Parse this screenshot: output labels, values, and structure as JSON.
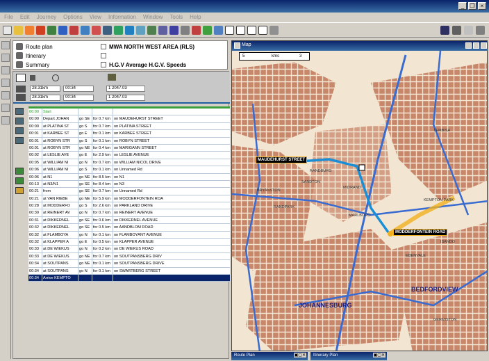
{
  "titlebar": {
    "title": "",
    "controls": [
      "_",
      "❐",
      "×"
    ]
  },
  "menubar": {
    "items": [
      "File",
      "Edit",
      "Journey",
      "Options",
      "View",
      "Information",
      "Window",
      "Tools",
      "Help"
    ]
  },
  "options": {
    "items": [
      {
        "label": "Route plan"
      },
      {
        "label": "Itinerary"
      },
      {
        "label": "Summary"
      }
    ],
    "area_label": "MWA NORTH WEST AREA (RLS)",
    "speed_label": "H.G.V Average H.G.V. Speeds"
  },
  "route_stats": {
    "row1": [
      "28.31km",
      "00:34",
      "1 2047.03"
    ],
    "row2": [
      "28.31km",
      "00:34",
      "1 2047.03"
    ]
  },
  "route_table": [
    {
      "time": "00:00",
      "desc": "Start",
      "dir": "",
      "dist": "",
      "road": "",
      "cls": "first"
    },
    {
      "time": "00:00",
      "desc": "Depart JOHAN",
      "dir": "go SE",
      "dist": "for 0.7 km",
      "road": "on MAUDEHURST STREET"
    },
    {
      "time": "00:00",
      "desc": "at PLATINA ST",
      "dir": "go S",
      "dist": "for 0.7 km",
      "road": "on PLATINA STREET"
    },
    {
      "time": "00:01",
      "desc": "at KARBEE ST",
      "dir": "go E",
      "dist": "for 0.1 km",
      "road": "on KARBEE STREET"
    },
    {
      "time": "00:01",
      "desc": "at ROBYN STR",
      "dir": "go S",
      "dist": "for 0.1 km",
      "road": "on ROBYN STREET"
    },
    {
      "time": "00:01",
      "desc": "at ROBYN STR",
      "dir": "go NE",
      "dist": "for 0.4 km",
      "road": "on MARIGANN STREET"
    },
    {
      "time": "00:02",
      "desc": "at LESLIE AVE",
      "dir": "go E",
      "dist": "for 2.9 km",
      "road": "on LESLIE AVENUE"
    },
    {
      "time": "00:05",
      "desc": "at WILLIAM NI",
      "dir": "go N",
      "dist": "for 0.7 km",
      "road": "on WILLIAM NICOL DRIVE"
    },
    {
      "time": "00:06",
      "desc": "at WILLIAM NI",
      "dir": "go S",
      "dist": "for 0.1 km",
      "road": "on Unnamed Rd"
    },
    {
      "time": "00:06",
      "desc": "at N1",
      "dir": "go NE",
      "dist": "for 8.5 km",
      "road": "on N1"
    },
    {
      "time": "00:13",
      "desc": "at N3/N1",
      "dir": "go SE",
      "dist": "for 8.4 km",
      "road": "on N3"
    },
    {
      "time": "00:21",
      "desc": "from",
      "dir": "go SE",
      "dist": "for 0.7 km",
      "road": "on Unnamed Rd"
    },
    {
      "time": "00:21",
      "desc": "at VAN RIEBE",
      "dir": "go NE",
      "dist": "for 5.9 km",
      "road": "on MODDERFONTEIN ROA"
    },
    {
      "time": "00:28",
      "desc": "at MODDERFO",
      "dir": "go S",
      "dist": "for 2.6 km",
      "road": "on PARKLAND DRIVE"
    },
    {
      "time": "00:30",
      "desc": "at REINERT AV",
      "dir": "go N",
      "dist": "for 0.7 km",
      "road": "on REINERT AVENUE"
    },
    {
      "time": "00:31",
      "desc": "at DIKKERNEL",
      "dir": "go SE",
      "dist": "for 0.6 km",
      "road": "on DIKKERNEL AVENUE"
    },
    {
      "time": "00:32",
      "desc": "at DIKKERNEL",
      "dir": "go SE",
      "dist": "for 0.5 km",
      "road": "on AANDBLOM ROAD"
    },
    {
      "time": "00:32",
      "desc": "at FLAMBOYA",
      "dir": "go N",
      "dist": "for 0.1 km",
      "road": "on FLAMBOYANT AVENUE"
    },
    {
      "time": "00:32",
      "desc": "at KLAPPER A",
      "dir": "go E",
      "dist": "for 0.5 km",
      "road": "on KLAPPER AVENUE"
    },
    {
      "time": "00:33",
      "desc": "at DE WIEKUS",
      "dir": "go N",
      "dist": "for 0.2 km",
      "road": "on DE WIEKUS ROAD"
    },
    {
      "time": "00:33",
      "desc": "at DE WIEKUS",
      "dir": "go NE",
      "dist": "for 0.7 km",
      "road": "on SOUTPANSBERG DRIV"
    },
    {
      "time": "00:34",
      "desc": "at SOUTPANS",
      "dir": "go NE",
      "dist": "for 0.1 km",
      "road": "on SOUTPANSBERG DRIVE"
    },
    {
      "time": "00:34",
      "desc": "at SOUTPANS",
      "dir": "go N",
      "dist": "for 0.1 km",
      "road": "on SWARTBERG STREET"
    },
    {
      "time": "00:34",
      "desc": "Arrive KEMPTO",
      "dir": "",
      "dist": "",
      "road": "",
      "cls": "sel"
    }
  ],
  "map": {
    "title": "Map",
    "scale": {
      "value": "5",
      "unit": "kms",
      "number": "3"
    },
    "tags": {
      "start": "MAUDEHURST STREET",
      "end": "MODDERFONTEIN ROAD"
    },
    "labels": {
      "randburg": "RANDBURG",
      "johannesburg": "JOHANNESBURG",
      "bedfordview": "BEDFORDVIEW",
      "kempton": "KEMPTON PARK",
      "germiston": "GERMISTON",
      "sandton": "SANDTON",
      "edenvale": "EDENVALE",
      "marlboro": "MARLBORO",
      "randpark": "RANDPARK",
      "bryanston": "BRYANSTON",
      "tembisa": "TEMBISA",
      "midrand": "MIDRAND",
      "isando": "ISANDO"
    },
    "colors": {
      "background": "#f2e6d2",
      "urban": "#c8866a",
      "main_road": "#3a6bd0",
      "route": "#1a8fd8",
      "highlight": "#f0b020"
    }
  },
  "bottom_tabs": [
    {
      "label": "Route Plan"
    },
    {
      "label": "Itinerary Plan"
    }
  ]
}
